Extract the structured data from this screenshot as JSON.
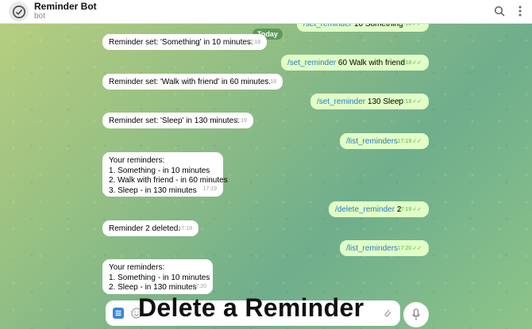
{
  "header": {
    "title": "Reminder Bot",
    "subtitle": "bot",
    "icons": [
      "search-icon",
      "kebab-menu-icon"
    ]
  },
  "day_label": "Today",
  "messages": [
    {
      "dir": "out",
      "command": "/set_reminder",
      "text": " 10 Something",
      "time": "17:18"
    },
    {
      "dir": "in",
      "text": "Reminder set: 'Something' in 10 minutes.",
      "time": "17:18"
    },
    {
      "dir": "out",
      "command": "/set_reminder",
      "text": " 60 Walk with friend",
      "time": "17:18"
    },
    {
      "dir": "in",
      "text": "Reminder set: 'Walk with friend' in 60 minutes.",
      "time": "17:18"
    },
    {
      "dir": "out",
      "command": "/set_reminder",
      "text": " 130 Sleep",
      "time": "17:19"
    },
    {
      "dir": "in",
      "text": "Reminder set: 'Sleep' in 130 minutes.",
      "time": "17:19"
    },
    {
      "dir": "out",
      "command": "/list_reminders",
      "text": "",
      "time": "17:19"
    },
    {
      "dir": "in",
      "lines": [
        "Your reminders:",
        "1. Something - in 10 minutes",
        "2. Walk with friend - in 60 minutes",
        "3. Sleep - in 130 minutes"
      ],
      "time": "17:19"
    },
    {
      "dir": "out",
      "command": "/delete_reminder",
      "text": " 2",
      "time": "17:19"
    },
    {
      "dir": "in",
      "text": "Reminder 2 deleted.",
      "time": "17:19"
    },
    {
      "dir": "out",
      "command": "/list_reminders",
      "text": "",
      "time": "17:20"
    },
    {
      "dir": "in",
      "lines": [
        "Your reminders:",
        "1. Something - in 10 minutes",
        "2. Sleep - in 130 minutes"
      ],
      "time": "17:20"
    }
  ],
  "composer": {
    "icons": [
      "menu-icon",
      "emoji-icon",
      "attach-icon",
      "microphone-icon"
    ]
  },
  "caption": "Delete a Reminder",
  "colors": {
    "incoming": "#ffffff",
    "outgoing": "#e1fec6",
    "command_link": "#2a78c2",
    "checkmark": "#5fae57"
  }
}
